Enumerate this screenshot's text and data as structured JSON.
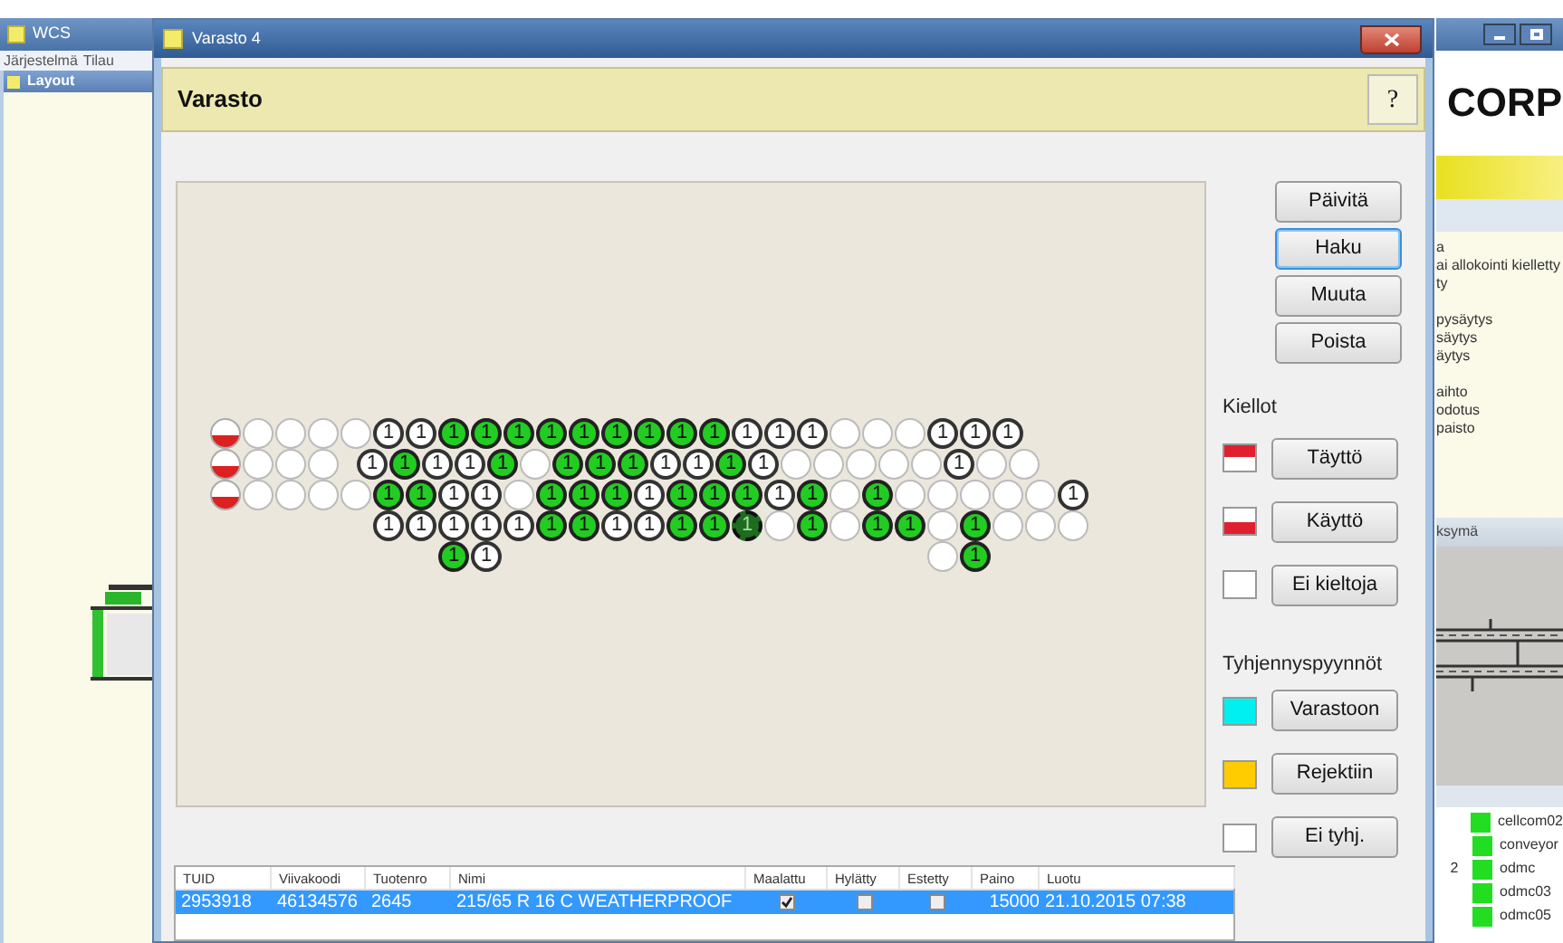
{
  "left_window": {
    "title": "WCS",
    "menu": [
      "Järjestelmä",
      "Tilau"
    ],
    "panel_title": "Layout"
  },
  "right_window": {
    "logo": "CORP",
    "status_groups": [
      [
        "a",
        "ai allokointi kielletty",
        "ty"
      ],
      [
        "pysäytys",
        "säytys",
        "äytys"
      ],
      [
        "aihto",
        "odotus",
        "paisto"
      ]
    ],
    "view_title": "ksymä",
    "devices": [
      {
        "label": "cellcom02",
        "color": "#22dd22"
      },
      {
        "label": "conveyor",
        "color": "#22dd22"
      },
      {
        "label": "odmc",
        "prefix": "2",
        "color": "#22dd22"
      },
      {
        "label": "odmc03",
        "color": "#22dd22"
      },
      {
        "label": "odmc05",
        "color": "#22dd22"
      }
    ]
  },
  "window": {
    "title": "Varasto 4",
    "header": "Varasto",
    "help": "?"
  },
  "map": {
    "rows": [
      [
        {
          "kind": "blocked"
        },
        {
          "kind": "empty"
        },
        {
          "kind": "empty"
        },
        {
          "kind": "empty"
        },
        {
          "kind": "empty"
        },
        {
          "kind": "reserved",
          "text": "1"
        },
        {
          "kind": "reserved",
          "text": "1"
        },
        {
          "kind": "full",
          "text": "1"
        },
        {
          "kind": "full",
          "text": "1"
        },
        {
          "kind": "full",
          "text": "1"
        },
        {
          "kind": "full",
          "text": "1"
        },
        {
          "kind": "full",
          "text": "1"
        },
        {
          "kind": "full",
          "text": "1"
        },
        {
          "kind": "full",
          "text": "1"
        },
        {
          "kind": "full",
          "text": "1"
        },
        {
          "kind": "full",
          "text": "1"
        },
        {
          "kind": "reserved",
          "text": "1"
        },
        {
          "kind": "reserved",
          "text": "1"
        },
        {
          "kind": "reserved",
          "text": "1"
        },
        {
          "kind": "empty"
        },
        {
          "kind": "empty"
        },
        {
          "kind": "empty"
        },
        {
          "kind": "reserved",
          "text": "1"
        },
        {
          "kind": "reserved",
          "text": "1"
        },
        {
          "kind": "reserved",
          "text": "1"
        }
      ],
      [
        {
          "kind": "blocked"
        },
        {
          "kind": "empty"
        },
        {
          "kind": "empty"
        },
        {
          "kind": "empty"
        },
        {
          "kind": "half_gap"
        },
        {
          "kind": "reserved",
          "text": "1"
        },
        {
          "kind": "full",
          "text": "1"
        },
        {
          "kind": "reserved",
          "text": "1"
        },
        {
          "kind": "reserved",
          "text": "1"
        },
        {
          "kind": "full",
          "text": "1"
        },
        {
          "kind": "empty"
        },
        {
          "kind": "full",
          "text": "1"
        },
        {
          "kind": "full",
          "text": "1"
        },
        {
          "kind": "full",
          "text": "1"
        },
        {
          "kind": "reserved",
          "text": "1"
        },
        {
          "kind": "reserved",
          "text": "1"
        },
        {
          "kind": "full",
          "text": "1"
        },
        {
          "kind": "reserved",
          "text": "1"
        },
        {
          "kind": "empty"
        },
        {
          "kind": "empty"
        },
        {
          "kind": "empty"
        },
        {
          "kind": "empty"
        },
        {
          "kind": "empty"
        },
        {
          "kind": "reserved",
          "text": "1"
        },
        {
          "kind": "empty"
        },
        {
          "kind": "empty"
        }
      ],
      [
        {
          "kind": "blocked"
        },
        {
          "kind": "empty"
        },
        {
          "kind": "empty"
        },
        {
          "kind": "empty"
        },
        {
          "kind": "empty"
        },
        {
          "kind": "full",
          "text": "1"
        },
        {
          "kind": "full",
          "text": "1"
        },
        {
          "kind": "reserved",
          "text": "1"
        },
        {
          "kind": "reserved",
          "text": "1"
        },
        {
          "kind": "empty"
        },
        {
          "kind": "full",
          "text": "1"
        },
        {
          "kind": "full",
          "text": "1"
        },
        {
          "kind": "full",
          "text": "1"
        },
        {
          "kind": "reserved",
          "text": "1"
        },
        {
          "kind": "full",
          "text": "1"
        },
        {
          "kind": "full",
          "text": "1"
        },
        {
          "kind": "full",
          "text": "1"
        },
        {
          "kind": "reserved",
          "text": "1"
        },
        {
          "kind": "full",
          "text": "1"
        },
        {
          "kind": "empty"
        },
        {
          "kind": "full",
          "text": "1"
        },
        {
          "kind": "empty"
        },
        {
          "kind": "empty"
        },
        {
          "kind": "empty"
        },
        {
          "kind": "empty"
        },
        {
          "kind": "empty"
        },
        {
          "kind": "reserved",
          "text": "1"
        }
      ],
      [
        {
          "kind": "gap"
        },
        {
          "kind": "gap"
        },
        {
          "kind": "gap"
        },
        {
          "kind": "gap"
        },
        {
          "kind": "gap"
        },
        {
          "kind": "reserved",
          "text": "1"
        },
        {
          "kind": "reserved",
          "text": "1"
        },
        {
          "kind": "reserved",
          "text": "1"
        },
        {
          "kind": "reserved",
          "text": "1"
        },
        {
          "kind": "reserved",
          "text": "1"
        },
        {
          "kind": "full",
          "text": "1"
        },
        {
          "kind": "full",
          "text": "1"
        },
        {
          "kind": "reserved",
          "text": "1"
        },
        {
          "kind": "reserved",
          "text": "1"
        },
        {
          "kind": "full",
          "text": "1"
        },
        {
          "kind": "full",
          "text": "1"
        },
        {
          "kind": "highlighted",
          "text": "1"
        },
        {
          "kind": "empty"
        },
        {
          "kind": "full",
          "text": "1"
        },
        {
          "kind": "empty"
        },
        {
          "kind": "full",
          "text": "1"
        },
        {
          "kind": "full",
          "text": "1"
        },
        {
          "kind": "empty"
        },
        {
          "kind": "full",
          "text": "1"
        },
        {
          "kind": "empty"
        },
        {
          "kind": "empty"
        },
        {
          "kind": "empty"
        }
      ],
      [
        {
          "kind": "gap"
        },
        {
          "kind": "gap"
        },
        {
          "kind": "gap"
        },
        {
          "kind": "gap"
        },
        {
          "kind": "gap"
        },
        {
          "kind": "gap"
        },
        {
          "kind": "gap"
        },
        {
          "kind": "full",
          "text": "1"
        },
        {
          "kind": "reserved",
          "text": "1"
        },
        {
          "kind": "gap"
        },
        {
          "kind": "gap"
        },
        {
          "kind": "gap"
        },
        {
          "kind": "gap"
        },
        {
          "kind": "gap"
        },
        {
          "kind": "gap"
        },
        {
          "kind": "gap"
        },
        {
          "kind": "gap"
        },
        {
          "kind": "gap"
        },
        {
          "kind": "gap"
        },
        {
          "kind": "gap"
        },
        {
          "kind": "gap"
        },
        {
          "kind": "gap"
        },
        {
          "kind": "empty"
        },
        {
          "kind": "full",
          "text": "1"
        }
      ]
    ]
  },
  "actions": [
    {
      "label": "Päivitä",
      "focused": false
    },
    {
      "label": "Haku",
      "focused": true
    },
    {
      "label": "Muuta",
      "focused": false
    },
    {
      "label": "Poista",
      "focused": false
    }
  ],
  "restrictions": {
    "title": "Kiellot",
    "items": [
      {
        "kind": "fill_block",
        "label": "Täyttö"
      },
      {
        "kind": "use_block",
        "label": "Käyttö"
      },
      {
        "kind": "none",
        "label": "Ei kieltoja"
      }
    ]
  },
  "empty_requests": {
    "title": "Tyhjennyspyynnöt",
    "items": [
      {
        "color": "#00f0f0",
        "label": "Varastoon"
      },
      {
        "color": "#ffcc00",
        "label": "Rejektiin"
      },
      {
        "color": "#ffffff",
        "label": "Ei tyhj."
      }
    ]
  },
  "table": {
    "columns": [
      "TUID",
      "Viivakoodi",
      "Tuotenro",
      "Nimi",
      "Maalattu",
      "Hylätty",
      "Estetty",
      "Paino",
      "Luotu"
    ],
    "rows": [
      {
        "selected": true,
        "cells": [
          {
            "kind": "text",
            "text": "2953918"
          },
          {
            "kind": "text",
            "text": "46134576"
          },
          {
            "kind": "text",
            "text": "2645"
          },
          {
            "kind": "text",
            "text": "215/65 R 16 C WEATHERPROOF"
          },
          {
            "kind": "check",
            "checked": true
          },
          {
            "kind": "check",
            "checked": false
          },
          {
            "kind": "check",
            "checked": false
          },
          {
            "kind": "number",
            "text": "15000"
          },
          {
            "kind": "text",
            "text": "21.10.2015 07:38"
          }
        ]
      }
    ]
  }
}
